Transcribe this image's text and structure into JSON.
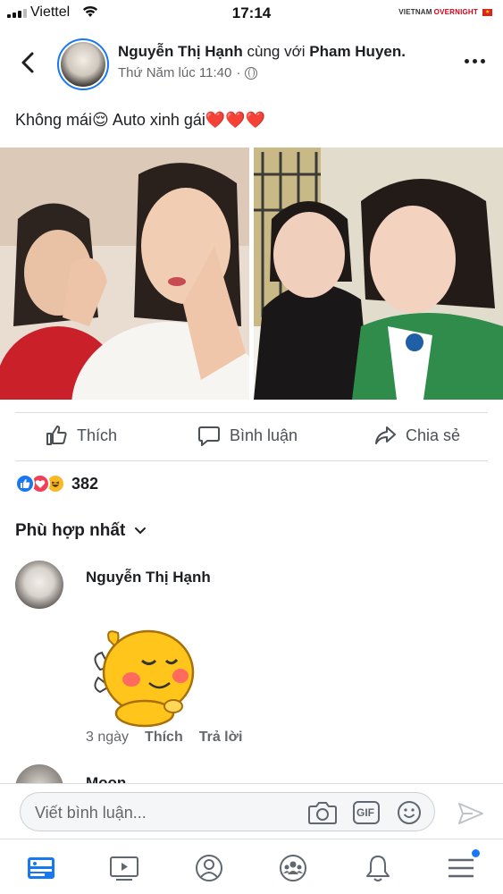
{
  "status_bar": {
    "carrier": "Viettel",
    "time": "17:14",
    "brand_left": "VIETNAM",
    "brand_right": "OVERNIGHT"
  },
  "post": {
    "author": "Nguyễn Thị Hạnh",
    "with_text": "cùng với",
    "tagged": "Pham Huyen.",
    "timestamp": "Thứ Năm lúc 11:40",
    "separator": "·",
    "caption": "Không mái😌 Auto xinh gái❤️❤️❤️"
  },
  "actions": {
    "like": "Thích",
    "comment": "Bình luận",
    "share": "Chia sẻ"
  },
  "reactions": {
    "count": "382"
  },
  "comments_sort": {
    "label": "Phù hợp nhất"
  },
  "comments": [
    {
      "author": "Nguyễn Thị Hạnh",
      "time": "3 ngày",
      "like": "Thích",
      "reply": "Trả lời"
    },
    {
      "author": "Moon"
    }
  ],
  "composer": {
    "placeholder": "Viết bình luận...",
    "gif_label": "GIF"
  },
  "colors": {
    "accent": "#1877f2",
    "love": "#f33e58",
    "haha": "#f7b928"
  }
}
